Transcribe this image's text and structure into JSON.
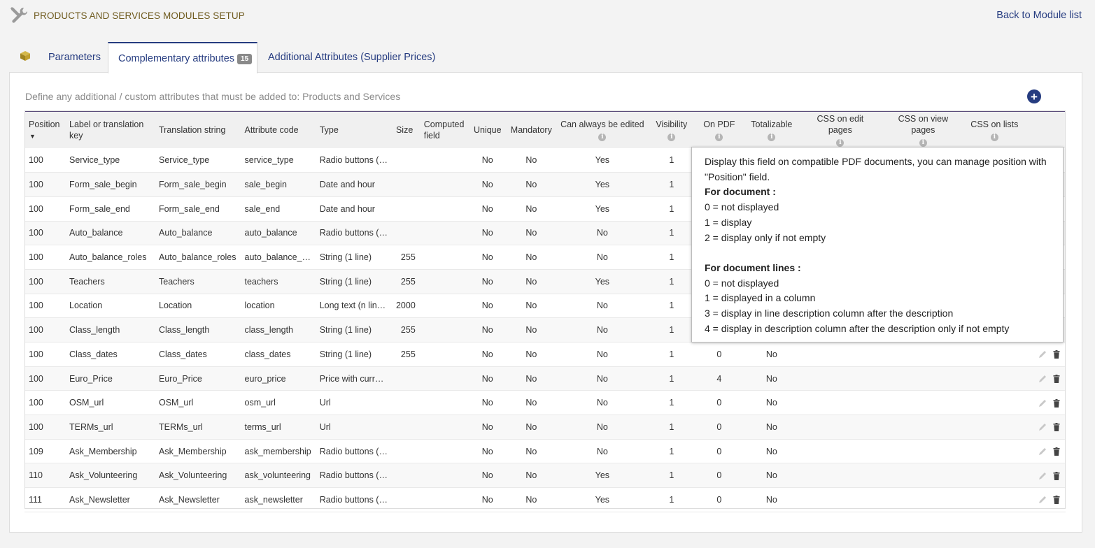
{
  "header": {
    "title": "PRODUCTS AND SERVICES MODULES SETUP",
    "back_link": "Back to Module list"
  },
  "tabs": {
    "parameters": "Parameters",
    "complementary": "Complementary attributes",
    "complementary_count": "15",
    "additional": "Additional Attributes (Supplier Prices)"
  },
  "panel": {
    "description": "Define any additional / custom attributes that must be added to: Products and Services"
  },
  "table": {
    "headers": {
      "position": "Position",
      "label": "Label or translation key",
      "translation": "Translation string",
      "code": "Attribute code",
      "type": "Type",
      "size": "Size",
      "computed": "Computed field",
      "unique": "Unique",
      "mandatory": "Mandatory",
      "always_edit": "Can always be edited",
      "visibility": "Visibility",
      "on_pdf": "On PDF",
      "totalizable": "Totalizable",
      "css_edit": "CSS on edit pages",
      "css_view": "CSS on view pages",
      "css_lists": "CSS on lists"
    },
    "rows": [
      {
        "position": "100",
        "label": "Service_type",
        "translation": "Service_type",
        "code": "service_type",
        "type": "Radio buttons (…",
        "size": "",
        "unique": "No",
        "mandatory": "No",
        "always_edit": "Yes",
        "visibility": "1",
        "on_pdf": "",
        "totalizable": ""
      },
      {
        "position": "100",
        "label": "Form_sale_begin",
        "translation": "Form_sale_begin",
        "code": "sale_begin",
        "type": "Date and hour",
        "size": "",
        "unique": "No",
        "mandatory": "No",
        "always_edit": "Yes",
        "visibility": "1",
        "on_pdf": "",
        "totalizable": ""
      },
      {
        "position": "100",
        "label": "Form_sale_end",
        "translation": "Form_sale_end",
        "code": "sale_end",
        "type": "Date and hour",
        "size": "",
        "unique": "No",
        "mandatory": "No",
        "always_edit": "Yes",
        "visibility": "1",
        "on_pdf": "",
        "totalizable": ""
      },
      {
        "position": "100",
        "label": "Auto_balance",
        "translation": "Auto_balance",
        "code": "auto_balance",
        "type": "Radio buttons (…",
        "size": "",
        "unique": "No",
        "mandatory": "No",
        "always_edit": "No",
        "visibility": "1",
        "on_pdf": "",
        "totalizable": ""
      },
      {
        "position": "100",
        "label": "Auto_balance_roles",
        "translation": "Auto_balance_roles",
        "code": "auto_balance_…",
        "type": "String (1 line)",
        "size": "255",
        "unique": "No",
        "mandatory": "No",
        "always_edit": "No",
        "visibility": "1",
        "on_pdf": "",
        "totalizable": ""
      },
      {
        "position": "100",
        "label": "Teachers",
        "translation": "Teachers",
        "code": "teachers",
        "type": "String (1 line)",
        "size": "255",
        "unique": "No",
        "mandatory": "No",
        "always_edit": "Yes",
        "visibility": "1",
        "on_pdf": "",
        "totalizable": ""
      },
      {
        "position": "100",
        "label": "Location",
        "translation": "Location",
        "code": "location",
        "type": "Long text (n lin…",
        "size": "2000",
        "unique": "No",
        "mandatory": "No",
        "always_edit": "No",
        "visibility": "1",
        "on_pdf": "",
        "totalizable": ""
      },
      {
        "position": "100",
        "label": "Class_length",
        "translation": "Class_length",
        "code": "class_length",
        "type": "String (1 line)",
        "size": "255",
        "unique": "No",
        "mandatory": "No",
        "always_edit": "No",
        "visibility": "1",
        "on_pdf": "",
        "totalizable": ""
      },
      {
        "position": "100",
        "label": "Class_dates",
        "translation": "Class_dates",
        "code": "class_dates",
        "type": "String (1 line)",
        "size": "255",
        "unique": "No",
        "mandatory": "No",
        "always_edit": "No",
        "visibility": "1",
        "on_pdf": "0",
        "totalizable": "No"
      },
      {
        "position": "100",
        "label": "Euro_Price",
        "translation": "Euro_Price",
        "code": "euro_price",
        "type": "Price with curr…",
        "size": "",
        "unique": "No",
        "mandatory": "No",
        "always_edit": "No",
        "visibility": "1",
        "on_pdf": "4",
        "totalizable": "No"
      },
      {
        "position": "100",
        "label": "OSM_url",
        "translation": "OSM_url",
        "code": "osm_url",
        "type": "Url",
        "size": "",
        "unique": "No",
        "mandatory": "No",
        "always_edit": "No",
        "visibility": "1",
        "on_pdf": "0",
        "totalizable": "No"
      },
      {
        "position": "100",
        "label": "TERMs_url",
        "translation": "TERMs_url",
        "code": "terms_url",
        "type": "Url",
        "size": "",
        "unique": "No",
        "mandatory": "No",
        "always_edit": "No",
        "visibility": "1",
        "on_pdf": "0",
        "totalizable": "No"
      },
      {
        "position": "109",
        "label": "Ask_Membership",
        "translation": "Ask_Membership",
        "code": "ask_membership",
        "type": "Radio buttons (…",
        "size": "",
        "unique": "No",
        "mandatory": "No",
        "always_edit": "No",
        "visibility": "1",
        "on_pdf": "0",
        "totalizable": "No"
      },
      {
        "position": "110",
        "label": "Ask_Volunteering",
        "translation": "Ask_Volunteering",
        "code": "ask_volunteering",
        "type": "Radio buttons (…",
        "size": "",
        "unique": "No",
        "mandatory": "No",
        "always_edit": "Yes",
        "visibility": "1",
        "on_pdf": "0",
        "totalizable": "No"
      },
      {
        "position": "111",
        "label": "Ask_Newsletter",
        "translation": "Ask_Newsletter",
        "code": "ask_newsletter",
        "type": "Radio buttons (…",
        "size": "",
        "unique": "No",
        "mandatory": "No",
        "always_edit": "Yes",
        "visibility": "1",
        "on_pdf": "0",
        "totalizable": "No"
      }
    ]
  },
  "tooltip": {
    "intro": "Display this field on compatible PDF documents, you can manage position with \"Position\" field.",
    "doc_heading": "For document :",
    "doc_lines": [
      "0 = not displayed",
      "1 = display",
      "2 = display only if not empty"
    ],
    "lines_heading": "For document lines :",
    "lines_lines": [
      "0 = not displayed",
      "1 = displayed in a column",
      "3 = display in line description column after the description",
      "4 = display in description column after the description only if not empty"
    ]
  },
  "icons": {
    "tools": "tools-icon",
    "module": "module-box-icon",
    "add": "plus-circle-icon",
    "info": "info-icon",
    "edit": "pencil-icon",
    "delete": "trash-icon"
  },
  "colors": {
    "link": "#263c80",
    "title": "#6f5b1f",
    "table_top_border": "#5b4d7a"
  }
}
